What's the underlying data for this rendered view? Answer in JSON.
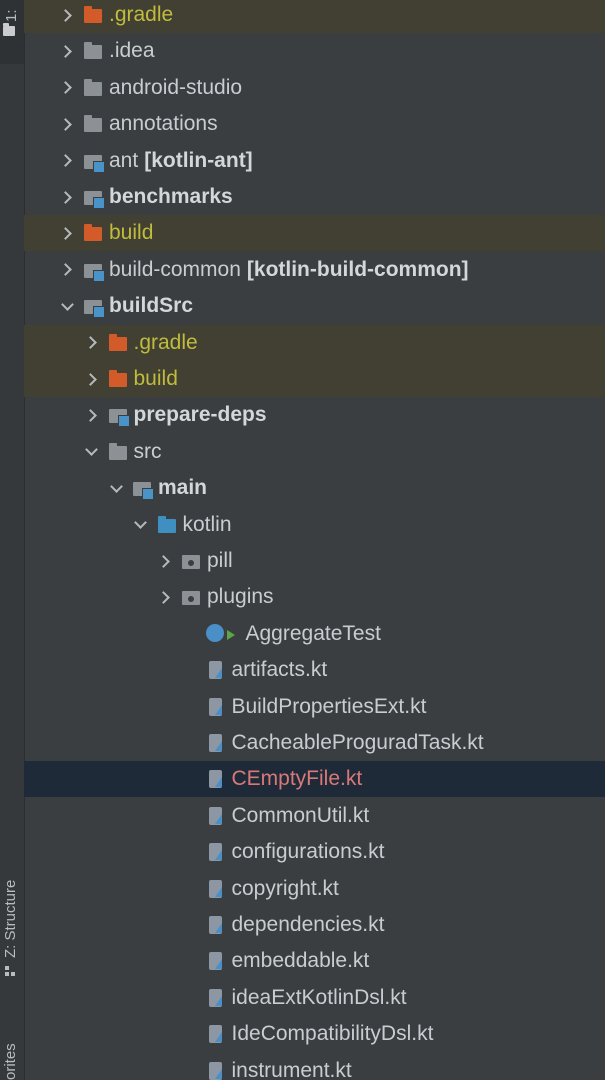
{
  "side_rail": {
    "project_tab": "1:",
    "structure_tab": "Z: Structure",
    "favorites_tab": "orites"
  },
  "tree": [
    {
      "label": ".gradle",
      "suffix": "",
      "arrow": "right",
      "icon": "folder-orange-icon",
      "style": "excluded"
    },
    {
      "label": ".idea",
      "suffix": "",
      "arrow": "right",
      "icon": "folder-icon",
      "style": "normal"
    },
    {
      "label": "android-studio",
      "suffix": "",
      "arrow": "right",
      "icon": "folder-icon",
      "style": "normal"
    },
    {
      "label": "annotations",
      "suffix": "",
      "arrow": "right",
      "icon": "folder-icon",
      "style": "normal"
    },
    {
      "label": "ant",
      "suffix": "[kotlin-ant]",
      "arrow": "right",
      "icon": "module-icon",
      "style": "normal"
    },
    {
      "label": "benchmarks",
      "suffix": "",
      "arrow": "right",
      "icon": "module-icon",
      "style": "bold"
    },
    {
      "label": "build",
      "suffix": "",
      "arrow": "right",
      "icon": "folder-orange-icon",
      "style": "excluded"
    },
    {
      "label": "build-common",
      "suffix": "[kotlin-build-common]",
      "arrow": "right",
      "icon": "module-icon",
      "style": "normal"
    },
    {
      "label": "buildSrc",
      "suffix": "",
      "arrow": "down",
      "icon": "module-icon",
      "style": "bold"
    },
    {
      "label": ".gradle",
      "suffix": "",
      "arrow": "right",
      "icon": "folder-orange-icon",
      "style": "excluded"
    },
    {
      "label": "build",
      "suffix": "",
      "arrow": "right",
      "icon": "folder-orange-icon",
      "style": "excluded"
    },
    {
      "label": "prepare-deps",
      "suffix": "",
      "arrow": "right",
      "icon": "module-icon",
      "style": "bold"
    },
    {
      "label": "src",
      "suffix": "",
      "arrow": "down",
      "icon": "folder-icon",
      "style": "normal"
    },
    {
      "label": "main",
      "suffix": "",
      "arrow": "down",
      "icon": "module-icon",
      "style": "bold"
    },
    {
      "label": "kotlin",
      "suffix": "",
      "arrow": "down",
      "icon": "folder-blue-icon",
      "style": "normal"
    },
    {
      "label": "pill",
      "suffix": "",
      "arrow": "right",
      "icon": "package-icon",
      "style": "normal"
    },
    {
      "label": "plugins",
      "suffix": "",
      "arrow": "right",
      "icon": "package-icon",
      "style": "normal"
    },
    {
      "label": "AggregateTest",
      "suffix": "",
      "arrow": "none",
      "icon": "test-class-icon",
      "style": "normal"
    },
    {
      "label": "artifacts.kt",
      "suffix": "",
      "arrow": "none",
      "icon": "kotlin-file-icon",
      "style": "normal"
    },
    {
      "label": "BuildPropertiesExt.kt",
      "suffix": "",
      "arrow": "none",
      "icon": "kotlin-file-icon",
      "style": "normal"
    },
    {
      "label": "CacheableProguradTask.kt",
      "suffix": "",
      "arrow": "none",
      "icon": "kotlin-file-icon",
      "style": "normal"
    },
    {
      "label": "CEmptyFile.kt",
      "suffix": "",
      "arrow": "none",
      "icon": "kotlin-file-icon",
      "style": "selected"
    },
    {
      "label": "CommonUtil.kt",
      "suffix": "",
      "arrow": "none",
      "icon": "kotlin-file-icon",
      "style": "normal"
    },
    {
      "label": "configurations.kt",
      "suffix": "",
      "arrow": "none",
      "icon": "kotlin-file-icon",
      "style": "normal"
    },
    {
      "label": "copyright.kt",
      "suffix": "",
      "arrow": "none",
      "icon": "kotlin-file-icon",
      "style": "normal"
    },
    {
      "label": "dependencies.kt",
      "suffix": "",
      "arrow": "none",
      "icon": "kotlin-file-icon",
      "style": "normal"
    },
    {
      "label": "embeddable.kt",
      "suffix": "",
      "arrow": "none",
      "icon": "kotlin-file-icon",
      "style": "normal"
    },
    {
      "label": "ideaExtKotlinDsl.kt",
      "suffix": "",
      "arrow": "none",
      "icon": "kotlin-file-icon",
      "style": "normal"
    },
    {
      "label": "IdeCompatibilityDsl.kt",
      "suffix": "",
      "arrow": "none",
      "icon": "kotlin-file-icon",
      "style": "normal"
    },
    {
      "label": "instrument.kt",
      "suffix": "",
      "arrow": "none",
      "icon": "kotlin-file-icon",
      "style": "normal"
    }
  ],
  "colors": {
    "background": "#3b3e40",
    "excluded_row": "#423f33",
    "excluded_text": "#c0bc3c",
    "selected_row": "#1f2a38",
    "modified_text": "#d87878"
  }
}
